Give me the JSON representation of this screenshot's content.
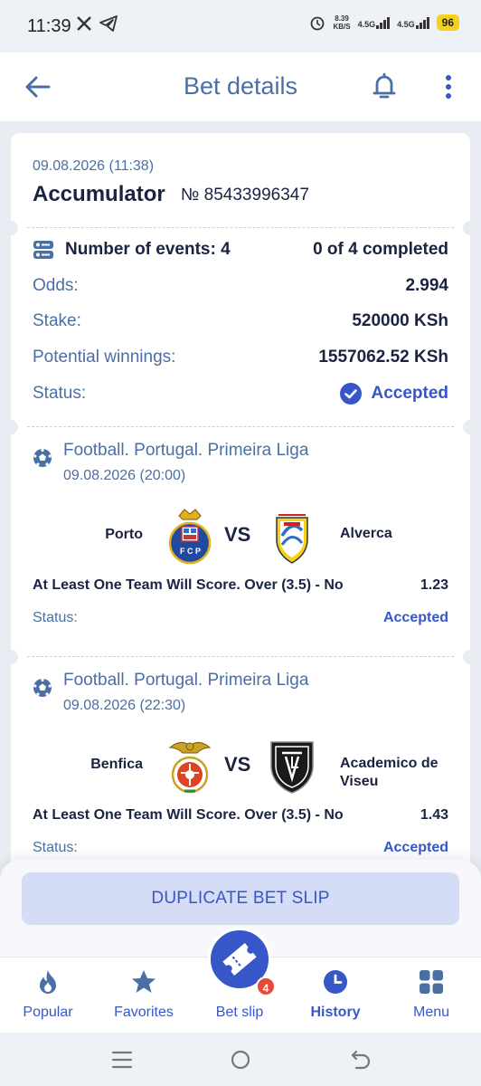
{
  "status_bar": {
    "time": "11:39",
    "speed_top": "8.39",
    "speed_bottom": "KB/S",
    "net1": "4.5G",
    "net2": "4.5G",
    "battery": "96"
  },
  "header": {
    "title": "Bet details"
  },
  "bet": {
    "date": "09.08.2026 (11:38)",
    "type": "Accumulator",
    "number": "№ 85433996347",
    "events_label": "Number of events: 4",
    "completed": "0 of 4 completed",
    "odds_label": "Odds:",
    "odds_value": "2.994",
    "stake_label": "Stake:",
    "stake_value": "520000 KSh",
    "winnings_label": "Potential winnings:",
    "winnings_value": "1557062.52 KSh",
    "status_label": "Status:",
    "status_value": "Accepted"
  },
  "events": [
    {
      "league": "Football. Portugal. Primeira Liga",
      "date": "09.08.2026 (20:00)",
      "home": "Porto",
      "vs": "VS",
      "away": "Alverca",
      "pick": "At Least One Team Will Score. Over (3.5) - No",
      "odds": "1.23",
      "status_label": "Status:",
      "status_value": "Accepted"
    },
    {
      "league": "Football. Portugal. Primeira Liga",
      "date": "09.08.2026 (22:30)",
      "home": "Benfica",
      "vs": "VS",
      "away": "Academico de Viseu",
      "pick": "At Least One Team Will Score. Over (3.5) - No",
      "odds": "1.43",
      "status_label": "Status:",
      "status_value": "Accepted"
    }
  ],
  "actions": {
    "duplicate_label": "DUPLICATE BET SLIP"
  },
  "nav": {
    "items": [
      {
        "label": "Popular",
        "icon": "flame-icon"
      },
      {
        "label": "Favorites",
        "icon": "star-icon"
      },
      {
        "label": "Bet slip",
        "icon": "ticket-icon"
      },
      {
        "label": "History",
        "icon": "clock-icon"
      },
      {
        "label": "Menu",
        "icon": "grid-icon"
      }
    ],
    "betslip_count": "4"
  },
  "colors": {
    "accent": "#3757c8",
    "muted_text": "#4a6fa5",
    "primary_text": "#1a2342",
    "badge": "#e64a3b"
  }
}
